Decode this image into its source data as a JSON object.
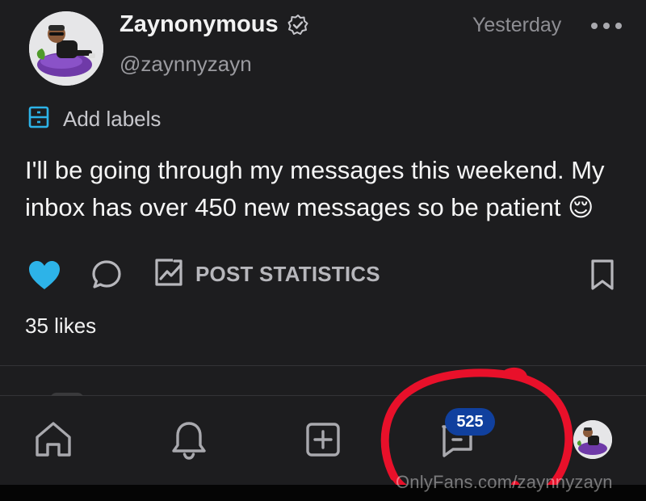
{
  "post": {
    "author_name": "Zaynonymous",
    "handle": "@zaynnyzayn",
    "timestamp": "Yesterday",
    "add_labels": "Add labels",
    "text": "I'll be going through my messages this weekend. My inbox has over 450 new messages so be patient 😌",
    "stats_label": "POST STATISTICS",
    "likes": "35 likes"
  },
  "nav": {
    "messages_badge": "525"
  },
  "watermark": "OnlyFans.com/zaynnyzayn",
  "colors": {
    "background": "#1d1d1f",
    "accent_blue": "#2db3e8",
    "badge_blue": "#10409e",
    "annotation_red": "#e8102a"
  },
  "icons": [
    "verified-icon",
    "more-icon",
    "labels-icon",
    "heart-icon",
    "comment-icon",
    "chart-icon",
    "bookmark-icon",
    "home-icon",
    "bell-icon",
    "add-icon",
    "messages-icon"
  ]
}
